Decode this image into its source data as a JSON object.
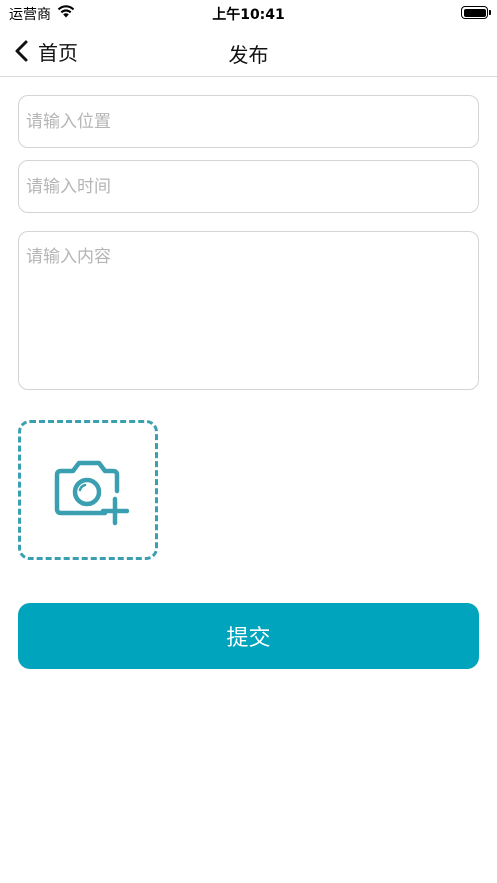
{
  "status_bar": {
    "carrier": "运营商",
    "time": "上午10:41"
  },
  "nav": {
    "back_label": "首页",
    "title": "发布"
  },
  "form": {
    "location_placeholder": "请输入位置",
    "time_placeholder": "请输入时间",
    "content_placeholder": "请输入内容",
    "location_value": "",
    "time_value": "",
    "content_value": ""
  },
  "upload": {
    "icon": "camera-add-icon",
    "accent_color": "#3a9fb1"
  },
  "submit": {
    "label": "提交",
    "color": "#00a4bc"
  }
}
